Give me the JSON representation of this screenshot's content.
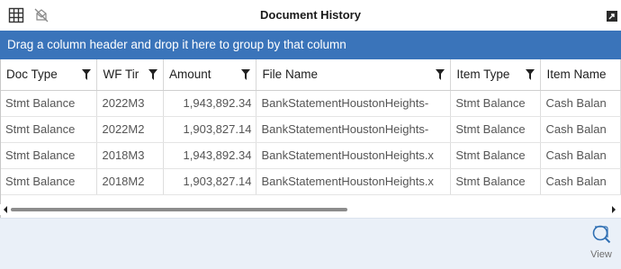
{
  "window": {
    "title": "Document History",
    "icons": [
      "grid-icon",
      "no-email-icon",
      "popout-icon"
    ]
  },
  "groupbar": {
    "text": "Drag a column header and drop it here to group by that column"
  },
  "grid": {
    "columns": [
      "Doc Type",
      "WF Tir",
      "Amount",
      "File Name",
      "Item Type",
      "Item Name"
    ],
    "rows": [
      [
        "Stmt Balance",
        "2022M3",
        "1,943,892.34",
        "BankStatementHoustonHeights-",
        "Stmt Balance",
        "Cash Balan"
      ],
      [
        "Stmt Balance",
        "2022M2",
        "1,903,827.14",
        "BankStatementHoustonHeights-",
        "Stmt Balance",
        "Cash Balan"
      ],
      [
        "Stmt Balance",
        "2018M3",
        "1,943,892.34",
        "BankStatementHoustonHeights.x",
        "Stmt Balance",
        "Cash Balan"
      ],
      [
        "Stmt Balance",
        "2018M2",
        "1,903,827.14",
        "BankStatementHoustonHeights.x",
        "Stmt Balance",
        "Cash Balan"
      ]
    ]
  },
  "toolbar": {
    "view_label": "View"
  },
  "colors": {
    "accent": "#3a74ba",
    "toolbar_bg": "#eaf0f8",
    "icon_blue": "#2f6fb3"
  }
}
